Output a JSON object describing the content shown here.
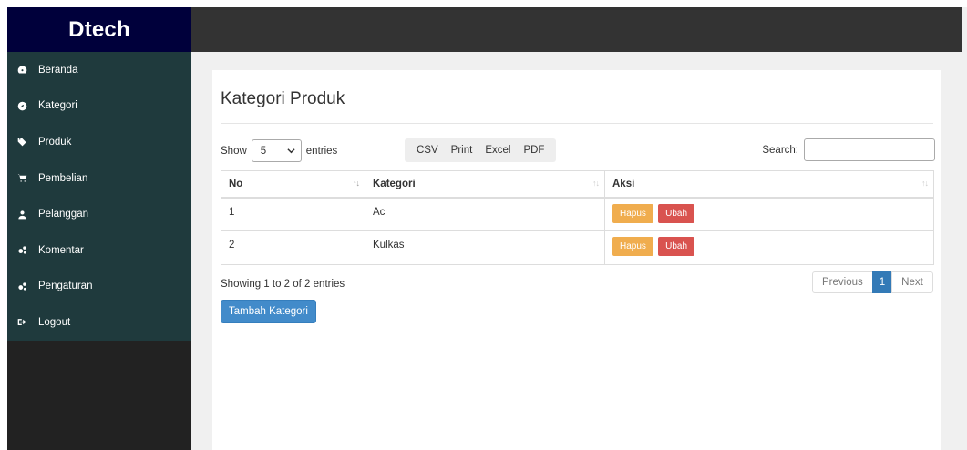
{
  "sidebar": {
    "brand": "Dtech",
    "items": [
      {
        "label": "Beranda",
        "icon": "dashboard-icon"
      },
      {
        "label": "Kategori",
        "icon": "compass-icon"
      },
      {
        "label": "Produk",
        "icon": "tag-icon"
      },
      {
        "label": "Pembelian",
        "icon": "cart-icon"
      },
      {
        "label": "Pelanggan",
        "icon": "user-icon"
      },
      {
        "label": "Komentar",
        "icon": "cogs-icon"
      },
      {
        "label": "Pengaturan",
        "icon": "cogs-icon"
      },
      {
        "label": "Logout",
        "icon": "sign-out-icon"
      }
    ]
  },
  "page": {
    "title": "Kategori Produk"
  },
  "table_controls": {
    "show_label": "Show",
    "entries_value": "5",
    "entries_label": "entries",
    "search_label": "Search:",
    "search_value": "",
    "export_buttons": [
      "CSV",
      "Print",
      "Excel",
      "PDF"
    ]
  },
  "table": {
    "columns": [
      "No",
      "Kategori",
      "Aksi"
    ],
    "rows": [
      {
        "no": "1",
        "kategori": "Ac",
        "hapus": "Hapus",
        "ubah": "Ubah"
      },
      {
        "no": "2",
        "kategori": "Kulkas",
        "hapus": "Hapus",
        "ubah": "Ubah"
      }
    ]
  },
  "footer": {
    "info": "Showing 1 to 2 of 2 entries",
    "pagination": {
      "previous": "Previous",
      "current": "1",
      "next": "Next"
    },
    "add_button": "Tambah Kategori"
  },
  "colors": {
    "brand_bg": "#00003b",
    "menu_bg": "#1f3a3d",
    "warn": "#f0ad4e",
    "danger": "#d9534f",
    "primary": "#428bca"
  }
}
